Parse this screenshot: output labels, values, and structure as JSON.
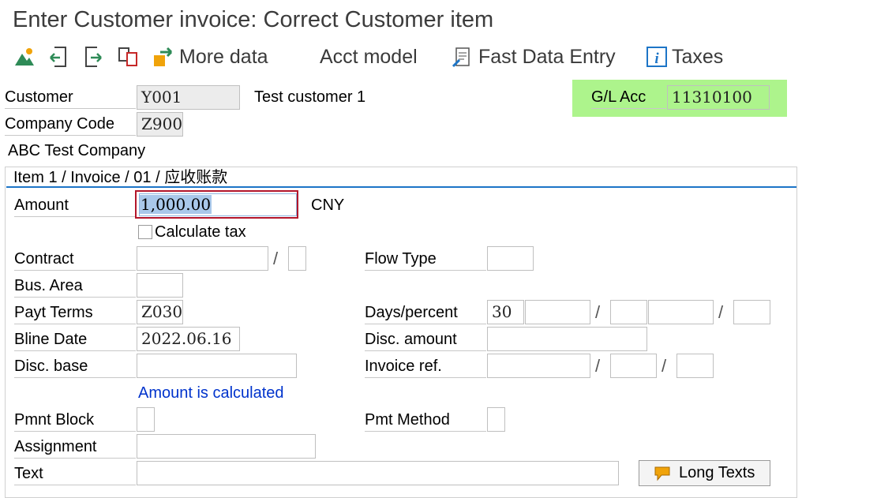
{
  "window": {
    "title": "Enter Customer invoice: Correct Customer item"
  },
  "toolbar": {
    "more_data": "More data",
    "acct_model": "Acct model",
    "fast_data_entry": "Fast Data Entry",
    "taxes": "Taxes"
  },
  "header": {
    "customer_label": "Customer",
    "customer_value": "Y001",
    "customer_name": "Test customer 1",
    "company_code_label": "Company Code",
    "company_code_value": "Z900",
    "company_name": "ABC Test Company",
    "gl_acc_label": "G/L Acc",
    "gl_acc_value": "11310100"
  },
  "item": {
    "tab_title": "Item 1 / Invoice / 01 / 应收账款",
    "amount_label": "Amount",
    "amount_value": "1,000.00",
    "currency": "CNY",
    "calculate_tax_label": "Calculate tax",
    "contract_label": "Contract",
    "contract_value": "",
    "contract_type_value": "",
    "flow_type_label": "Flow Type",
    "flow_type_value": "",
    "bus_area_label": "Bus. Area",
    "bus_area_value": "",
    "payt_terms_label": "Payt Terms",
    "payt_terms_value": "Z030",
    "days_percent_label": "Days/percent",
    "days1": "30",
    "pct1": "",
    "days2": "",
    "pct2": "",
    "days3": "",
    "bline_date_label": "Bline Date",
    "bline_date_value": "2022.06.16",
    "disc_amount_label": "Disc. amount",
    "disc_amount_value": "",
    "disc_base_label": "Disc. base",
    "disc_base_value": "",
    "invoice_ref_label": "Invoice ref.",
    "invoice_ref_value": "",
    "invoice_ref_year": "",
    "invoice_ref_item": "",
    "amount_calculated_note": "Amount is calculated",
    "pmnt_block_label": "Pmnt Block",
    "pmnt_block_value": "",
    "pmt_method_label": "Pmt Method",
    "pmt_method_value": "",
    "assignment_label": "Assignment",
    "assignment_value": "",
    "text_label": "Text",
    "text_value": "",
    "long_texts_label": "Long Texts"
  },
  "colors": {
    "gl_highlight": "#adf48c",
    "link_blue": "#0033cc",
    "tab_underline": "#1d75c7",
    "icon_green": "#2e8b57",
    "icon_orange": "#f0a30a"
  }
}
